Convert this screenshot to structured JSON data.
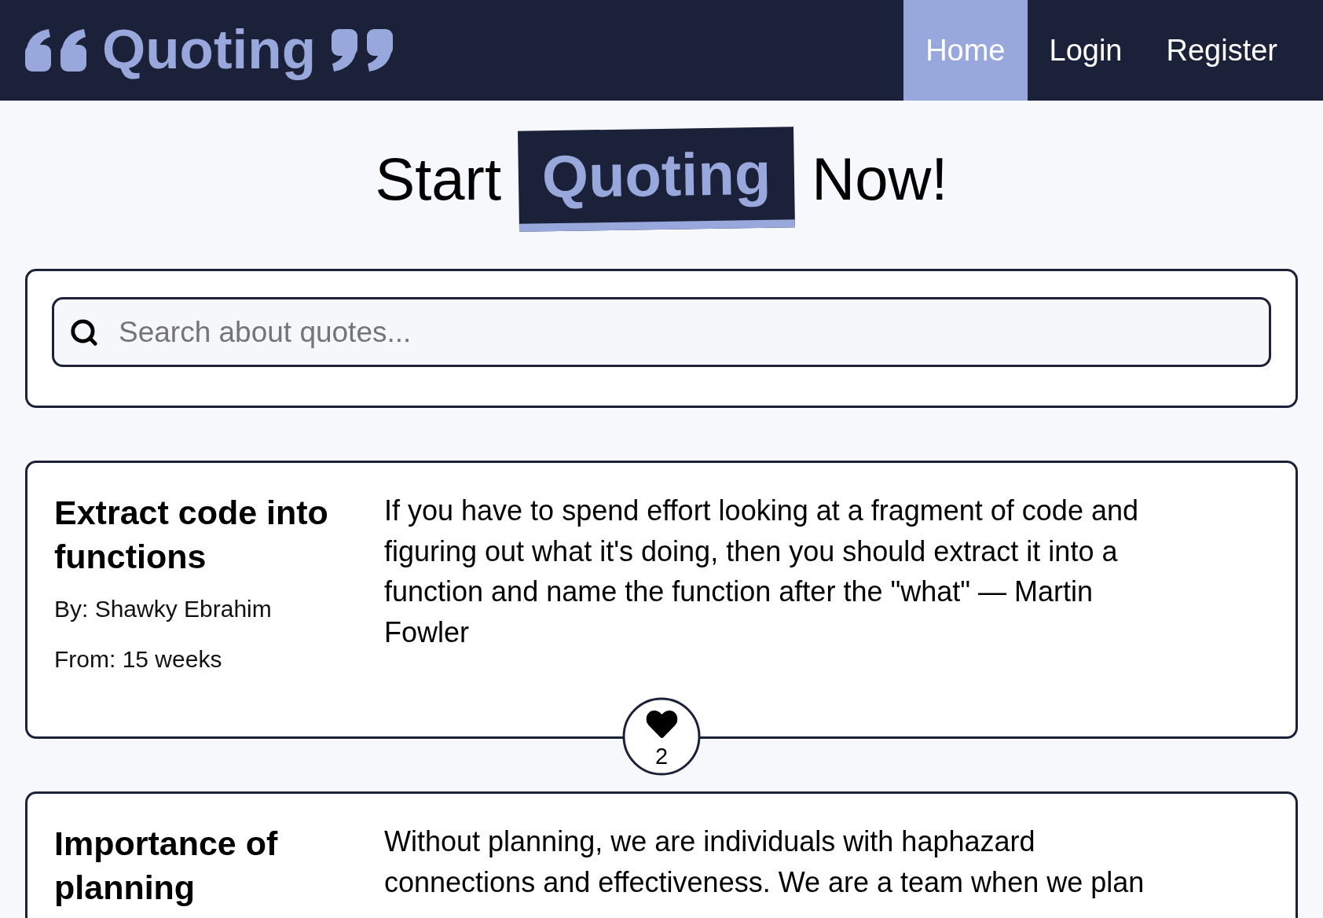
{
  "header": {
    "logo": "Quoting",
    "nav": [
      {
        "label": "Home",
        "selected": true
      },
      {
        "label": "Login",
        "selected": false
      },
      {
        "label": "Register",
        "selected": false
      }
    ]
  },
  "hero": {
    "before": "Start",
    "highlight": "Quoting",
    "after": "Now!"
  },
  "search": {
    "placeholder": "Search about quotes..."
  },
  "quotes": [
    {
      "title": "Extract code into functions",
      "author": "By: Shawky Ebrahim",
      "age": "From: 15 weeks",
      "text": "If you have to spend effort looking at a fragment of code and figuring out what it's doing, then you should extract it into a function and name the function after the \"what\" — Martin Fowler",
      "likes": "2"
    },
    {
      "title": "Importance of planning",
      "text": "Without planning, we are individuals with haphazard connections and effectiveness. We are a team when we plan"
    }
  ]
}
